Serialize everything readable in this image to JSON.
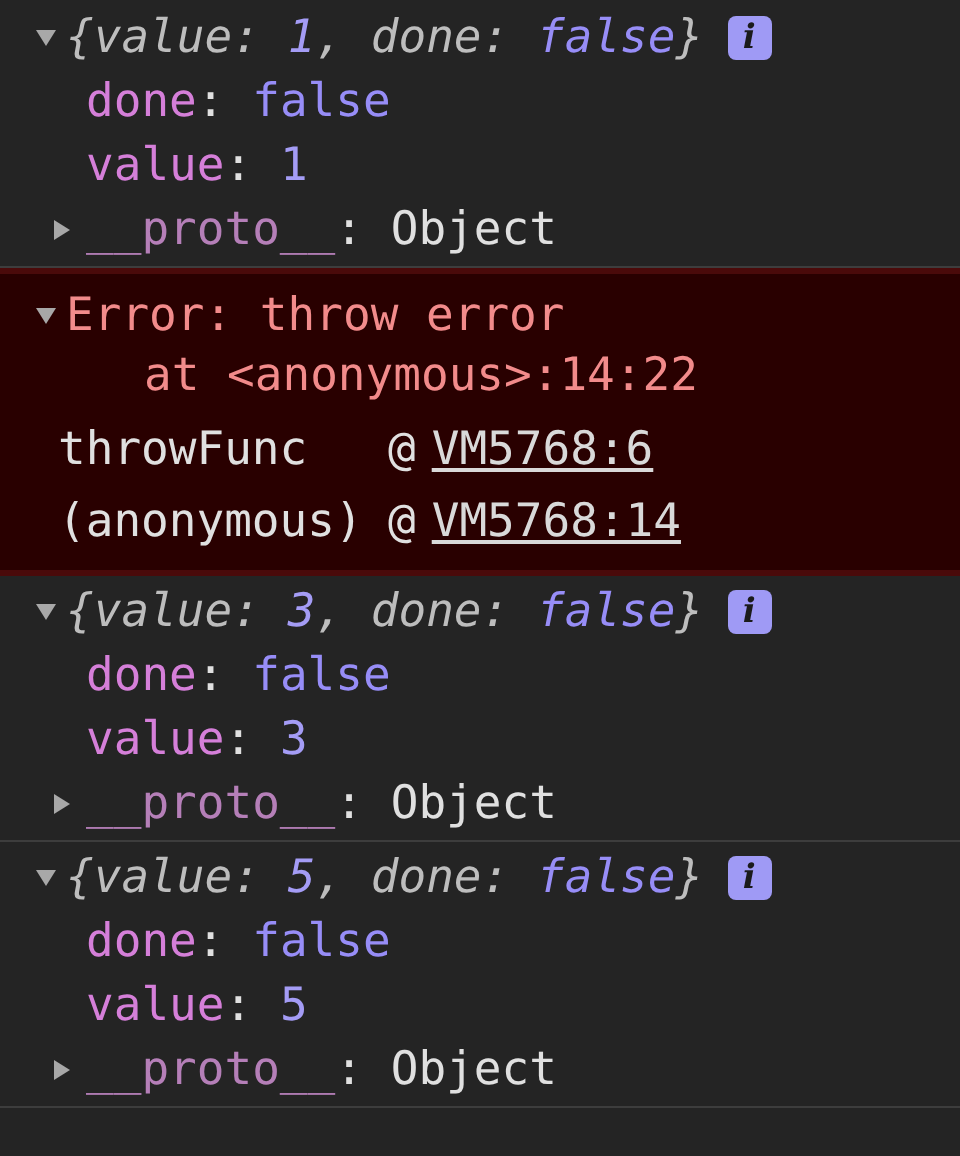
{
  "entries": [
    {
      "kind": "object",
      "expanded": true,
      "preview": {
        "open": "{",
        "items": [
          {
            "key": "value",
            "colon": ":",
            "value": "1",
            "kind": "number",
            "after": ","
          },
          {
            "key": "done",
            "colon": ":",
            "value": "false",
            "kind": "boolean"
          }
        ],
        "close": "}"
      },
      "properties": [
        {
          "key": "done",
          "colon": ":",
          "value": "false",
          "kind": "boolean"
        },
        {
          "key": "value",
          "colon": ":",
          "value": "1",
          "kind": "number"
        }
      ],
      "proto": {
        "key": "__proto__",
        "colon": ":",
        "value": "Object",
        "expanded": false
      },
      "info_badge": "i"
    },
    {
      "kind": "error",
      "expanded": true,
      "message": "Error: throw error",
      "location": "at <anonymous>:14:22",
      "frames": [
        {
          "function": "throwFunc",
          "at": "@",
          "link": "VM5768:6"
        },
        {
          "function": "(anonymous)",
          "at": "@",
          "link": "VM5768:14"
        }
      ]
    },
    {
      "kind": "object",
      "expanded": true,
      "preview": {
        "open": "{",
        "items": [
          {
            "key": "value",
            "colon": ":",
            "value": "3",
            "kind": "number",
            "after": ","
          },
          {
            "key": "done",
            "colon": ":",
            "value": "false",
            "kind": "boolean"
          }
        ],
        "close": "}"
      },
      "properties": [
        {
          "key": "done",
          "colon": ":",
          "value": "false",
          "kind": "boolean"
        },
        {
          "key": "value",
          "colon": ":",
          "value": "3",
          "kind": "number"
        }
      ],
      "proto": {
        "key": "__proto__",
        "colon": ":",
        "value": "Object",
        "expanded": false
      },
      "info_badge": "i"
    },
    {
      "kind": "object",
      "expanded": true,
      "preview": {
        "open": "{",
        "items": [
          {
            "key": "value",
            "colon": ":",
            "value": "5",
            "kind": "number",
            "after": ","
          },
          {
            "key": "done",
            "colon": ":",
            "value": "false",
            "kind": "boolean"
          }
        ],
        "close": "}"
      },
      "properties": [
        {
          "key": "done",
          "colon": ":",
          "value": "false",
          "kind": "boolean"
        },
        {
          "key": "value",
          "colon": ":",
          "value": "5",
          "kind": "number"
        }
      ],
      "proto": {
        "key": "__proto__",
        "colon": ":",
        "value": "Object",
        "expanded": false
      },
      "info_badge": "i"
    }
  ]
}
